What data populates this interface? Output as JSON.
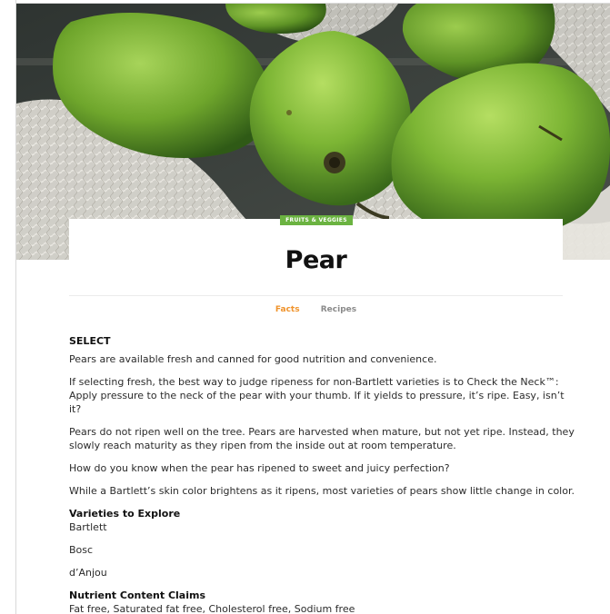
{
  "hero": {
    "image": "pears-on-cheesecloth"
  },
  "article": {
    "category": "FRUITS & VEGGIES",
    "title": "Pear"
  },
  "tabs": [
    {
      "label": "Facts",
      "active": true
    },
    {
      "label": "Recipes",
      "active": false
    }
  ],
  "content": {
    "select_heading": "SELECT",
    "paragraphs": [
      "Pears are available fresh and canned for good nutrition and convenience.",
      "If selecting fresh, the best way to judge ripeness for non-Bartlett varieties is to Check the Neck™: Apply pressure to the neck of the pear with your thumb. If it yields to pressure, it’s ripe. Easy, isn’t it?",
      "Pears do not ripen well on the tree. Pears are harvested when mature, but not yet ripe. Instead, they slowly reach maturity as they ripen from the inside out at room temperature.",
      "How do you know when the pear has ripened to sweet and juicy perfection?",
      "While a Bartlett’s skin color brightens as it ripens, most varieties of pears show little change in color."
    ],
    "varieties_heading": "Varieties to Explore",
    "varieties": [
      "Bartlett",
      "Bosc",
      "d’Anjou"
    ],
    "nutrient_heading": "Nutrient Content Claims",
    "nutrient_claims": "Fat free, Saturated fat free, Cholesterol free, Sodium free"
  },
  "colors": {
    "badge": "#6bb341",
    "tab_active": "#f0932b",
    "tab_inactive": "#8a8a8a",
    "pear_green": "#7fb33a"
  }
}
